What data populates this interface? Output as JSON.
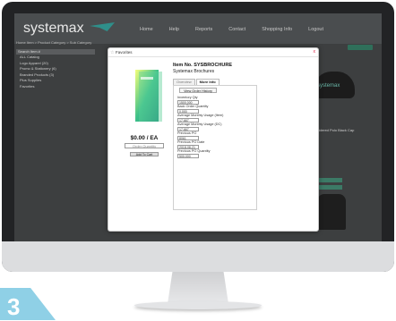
{
  "site": {
    "logo": "systemax",
    "nav": [
      "Home",
      "Help",
      "Reports",
      "Contact",
      "Shopping Info",
      "Logout"
    ],
    "breadcrumb": "Home Item > Product Category > Sub Category",
    "sidebar": {
      "title": "Search Item #",
      "items": [
        "ALL Catalog",
        "Logo Apparel (20)",
        "Promo & Stationery (6)",
        "Branded Products (3)",
        "Plus Supplies",
        "Favorites"
      ]
    },
    "right_product_label": "Embroidered Polo Black Cap",
    "cap_text": "systemax"
  },
  "modal": {
    "title": "Favorites",
    "close": "x",
    "price": "$0.00 / EA",
    "qty_placeholder": "Order Quantity",
    "add_to_cart": "Add To Cart",
    "item_number": "Item No. SYSBROCHURE",
    "item_name": "Systemax Brochures",
    "tabs": [
      "Overview",
      "More Info"
    ],
    "view_order_history": "View Order History",
    "fields": [
      {
        "label": "Inventory Qty",
        "value": "1500.000"
      },
      {
        "label": "Back Order Quantity",
        "value": "0.000"
      },
      {
        "label": "Average Monthly Usage (Item)",
        "value": "17.667"
      },
      {
        "label": "Average Monthly Usage (DC)",
        "value": "17.667"
      },
      {
        "label": "Previous PO",
        "value": "8061"
      },
      {
        "label": "Previous PO Date",
        "value": "2018-08-21"
      },
      {
        "label": "Previous PO Quantity",
        "value": "500.000"
      }
    ]
  },
  "step_number": "3",
  "colors": {
    "accent": "#2f8f8a",
    "step_badge": "#8fd0e6",
    "close": "#dd2244"
  }
}
